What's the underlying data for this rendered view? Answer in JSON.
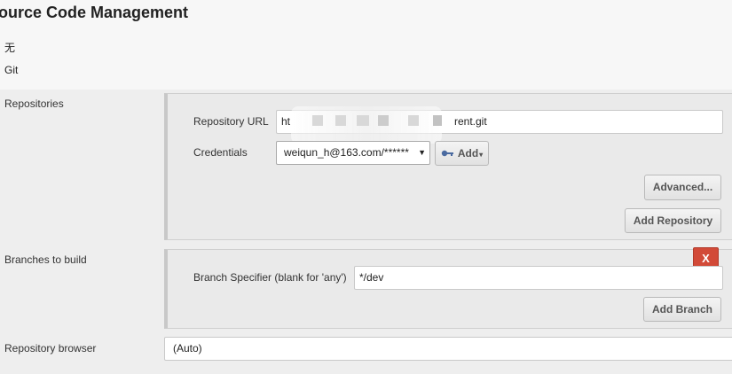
{
  "section": {
    "title": "ource Code Management",
    "scm_options": [
      "无",
      "Git"
    ]
  },
  "repositories": {
    "label": "Repositories",
    "url_label": "Repository URL",
    "url_prefix": "ht",
    "url_suffix": "rent.git",
    "credentials_label": "Credentials",
    "credentials_value": "weiqun_h@163.com/******",
    "add_label": "Add",
    "advanced_label": "Advanced...",
    "add_repository_label": "Add Repository"
  },
  "branches": {
    "label": "Branches to build",
    "delete_label": "X",
    "specifier_label": "Branch Specifier (blank for 'any')",
    "specifier_value": "*/dev",
    "add_branch_label": "Add Branch"
  },
  "browser": {
    "label": "Repository browser",
    "value": "(Auto)"
  },
  "colors": {
    "delete_button": "#d24a38",
    "band": "#eeeeee",
    "panel": "#eaeaea"
  }
}
